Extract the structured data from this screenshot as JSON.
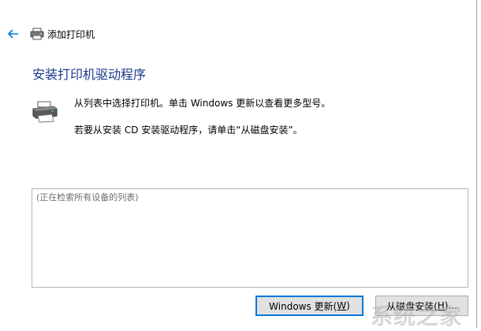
{
  "window": {
    "title": "添加打印机",
    "icons": {
      "back": "back-arrow-icon",
      "title": "printer-icon"
    }
  },
  "page": {
    "heading": "安装打印机驱动程序",
    "instruction_1": "从列表中选择打印机。单击 Windows 更新以查看更多型号。",
    "instruction_2": "若要从安装 CD 安装驱动程序，请单击“从磁盘安装”。"
  },
  "device_list": {
    "placeholder": "(正在检索所有设备的列表)"
  },
  "buttons": {
    "windows_update_label": "Windows 更新(",
    "windows_update_key": "W",
    "windows_update_suffix": ")",
    "from_disk_label": "从磁盘安装(",
    "from_disk_key": "H",
    "from_disk_suffix": ")..."
  },
  "colors": {
    "heading": "#1a3a8a",
    "accent": "#0078d7",
    "back_arrow": "#0078d7"
  },
  "watermark": "系统之家"
}
